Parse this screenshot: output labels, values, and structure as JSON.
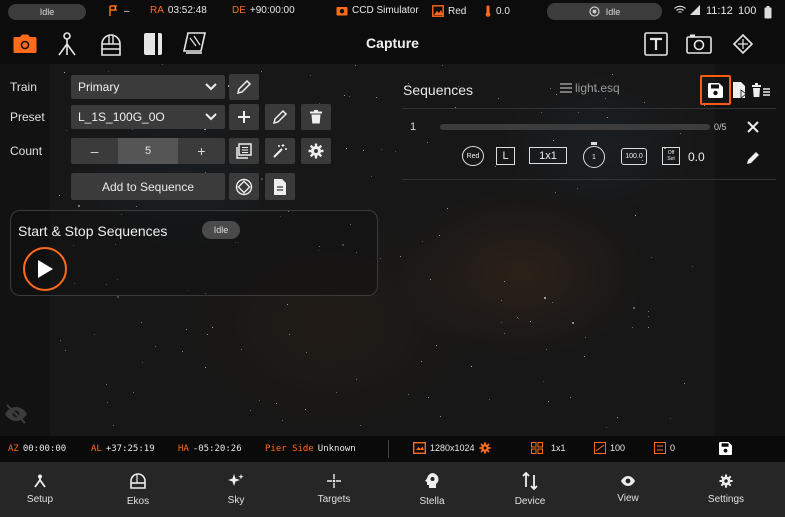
{
  "status_bar": {
    "left_pill": "Idle",
    "mount_status": "–",
    "ra_label": "RA",
    "ra_value": "03:52:48",
    "de_label": "DE",
    "de_value": "+90:00:00",
    "camera": "CCD Simulator",
    "filter": "Red",
    "temperature": "0.0",
    "right_pill": "Idle",
    "time": "11:12",
    "battery": "100"
  },
  "toolbar": {
    "title": "Capture",
    "left_icons": [
      "camera-icon",
      "mount-icon",
      "dome-icon",
      "notebook-icon",
      "flat-panel-icon"
    ],
    "right_icons": [
      "text-icon",
      "frame-icon",
      "rotate-icon"
    ]
  },
  "form": {
    "train_label": "Train",
    "train_value": "Primary",
    "preset_label": "Preset",
    "preset_value": "L_1S_100G_0O",
    "count_label": "Count",
    "count_minus": "–",
    "count_value": "5",
    "count_plus": "+",
    "add_to_sequence": "Add to Sequence"
  },
  "start_stop": {
    "title": "Start & Stop Sequences",
    "badge": "Idle"
  },
  "sequences": {
    "title": "Sequences",
    "file": "light.esq",
    "jobs": [
      {
        "index": "1",
        "progress_text": "0/5",
        "progress_fraction": 0,
        "filter": "Red",
        "type": "L",
        "binning": "1x1",
        "exposure": "1",
        "gain": "100.0",
        "offset_label_top": "Off",
        "offset_label_bottom": "Set",
        "delay": "0.0"
      }
    ]
  },
  "bottom_status": {
    "az_label": "AZ",
    "az_value": "00:00:00",
    "al_label": "AL",
    "al_value": "+37:25:19",
    "ha_label": "HA",
    "ha_value": "-05:20:26",
    "pier_label": "Pier Side",
    "pier_value": "Unknown",
    "resolution": "1280x1024",
    "binning": "1x1",
    "gain": "100",
    "offset": "0"
  },
  "nav": {
    "items": [
      {
        "label": "Setup",
        "icon": "setup-icon"
      },
      {
        "label": "Ekos",
        "icon": "ekos-icon"
      },
      {
        "label": "Sky",
        "icon": "sky-icon"
      },
      {
        "label": "Targets",
        "icon": "targets-icon"
      },
      {
        "label": "Stella",
        "icon": "stella-icon"
      },
      {
        "label": "Device",
        "icon": "device-icon"
      },
      {
        "label": "View",
        "icon": "view-icon"
      },
      {
        "label": "Settings",
        "icon": "settings-icon"
      }
    ]
  },
  "colors": {
    "accent": "#ff6b1a",
    "background": "#101010",
    "panel": "#3b3b3b",
    "nav": "#262626"
  }
}
